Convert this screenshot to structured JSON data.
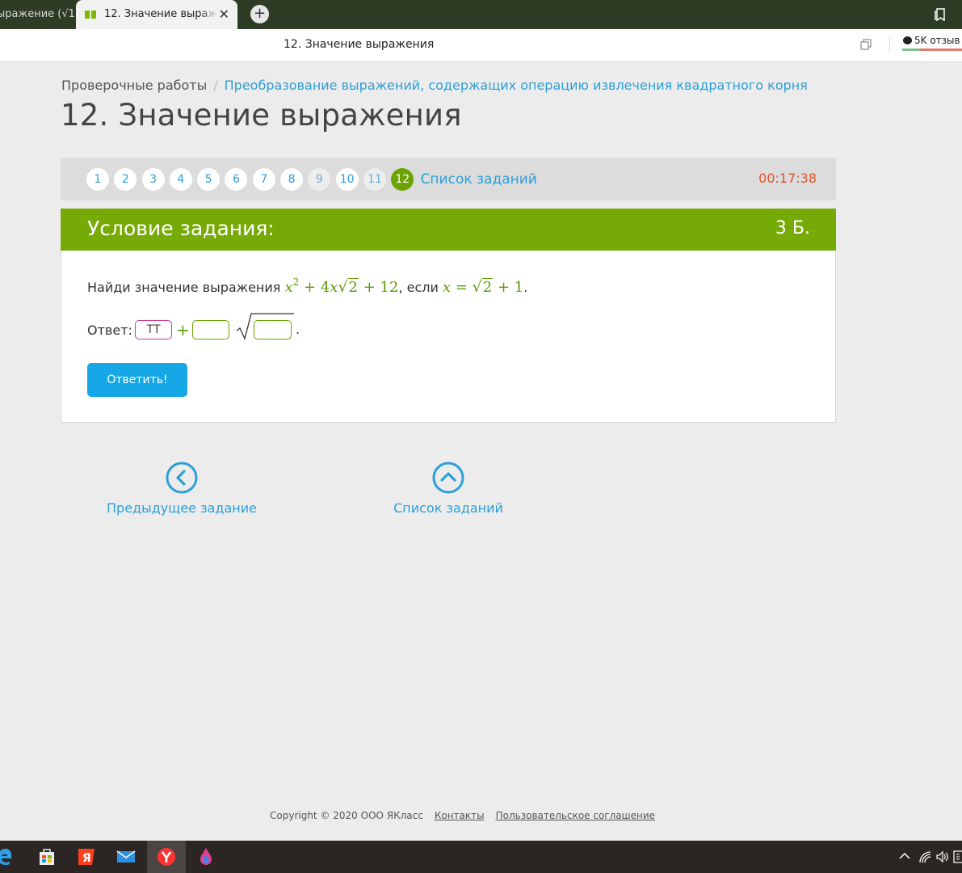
{
  "browser": {
    "inactive_tab_title": "ыражение (√1",
    "active_tab_title": "12. Значение выражени",
    "close_glyph": "✕",
    "new_tab_glyph": "+",
    "address_title": "12. Значение выражения",
    "reviews_label": "5K отзыв"
  },
  "breadcrumb": {
    "root": "Проверочные работы",
    "separator": "/",
    "current": "Преобразование выражений, содержащих операцию извлечения квадратного корня"
  },
  "page_title": "12. Значение выражения",
  "task_nav": {
    "numbers": [
      "1",
      "2",
      "3",
      "4",
      "5",
      "6",
      "7",
      "8",
      "9",
      "10",
      "11",
      "12"
    ],
    "current": "12",
    "task_list_label": "Список заданий",
    "timer": "00:17:38"
  },
  "condition": {
    "header": "Условие задания:",
    "points": "3 Б.",
    "text_prefix": "Найди значение выражения",
    "text_middle": ", если",
    "text_suffix": "."
  },
  "answer": {
    "label": "Ответ:",
    "box_a_value": "ТТ",
    "box_b_value": "",
    "box_c_value": "",
    "period": ".",
    "submit_label": "Ответить!"
  },
  "bottom_nav": {
    "prev_label": "Предыдущее задание",
    "list_label": "Список заданий"
  },
  "footer": {
    "copyright": "Copyright © 2020 ООО ЯКласс",
    "contacts": "Контакты",
    "agreement": "Пользовательское соглашение"
  },
  "colors": {
    "accent_green": "#76aa06",
    "link_blue": "#2c9fd9",
    "timer_red": "#e0542a",
    "button_blue": "#16a8e6"
  },
  "taskbar": {
    "apps": [
      "edge-icon",
      "store-icon",
      "yandex-y-icon",
      "mail-icon",
      "yandex-browser-icon",
      "paint-drop-icon"
    ]
  }
}
